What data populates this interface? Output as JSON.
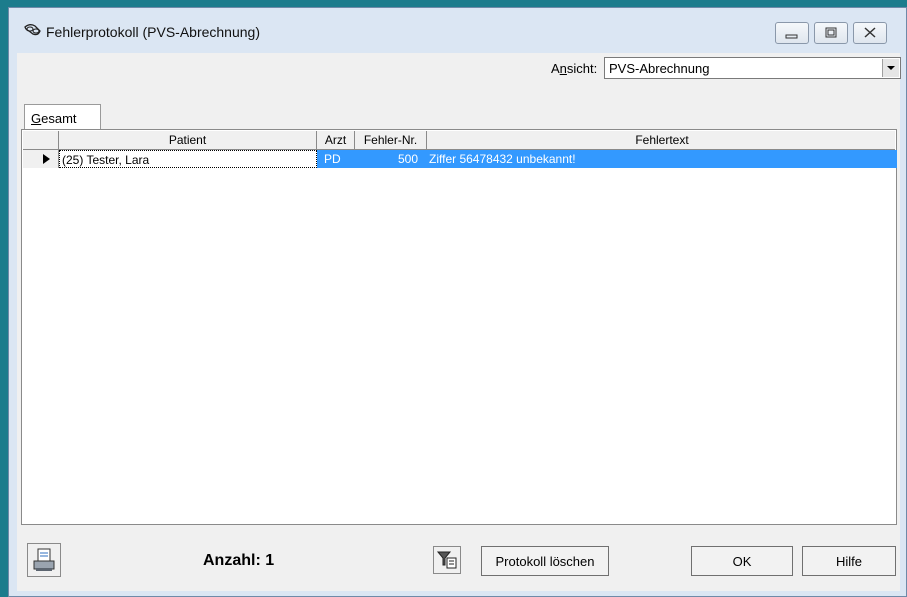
{
  "window": {
    "title": "Fehlerprotokoll (PVS-Abrechnung)"
  },
  "view": {
    "label": "Ansicht:",
    "value": "PVS-Abrechnung"
  },
  "tabs": [
    {
      "label": "Gesamt"
    }
  ],
  "grid": {
    "columns": [
      "Patient",
      "Arzt",
      "Fehler-Nr.",
      "Fehlertext"
    ],
    "rows": [
      {
        "patient": "(25) Tester, Lara",
        "arzt": "PD",
        "fehler_nr": "500",
        "fehlertext": "Ziffer 56478432 unbekannt!"
      }
    ]
  },
  "footer": {
    "count_label": "Anzahl: 1",
    "delete_label": "Protokoll löschen",
    "ok_label": "OK",
    "help_label": "Hilfe"
  },
  "colors": {
    "selection": "#3399ff",
    "frame": "#dbe6f3",
    "desktop": "#1c7c8c"
  },
  "icons": {
    "title": "glasses-icon",
    "print": "printer-icon",
    "filter": "filter-icon",
    "row_indicator": "triangle-right-icon"
  }
}
